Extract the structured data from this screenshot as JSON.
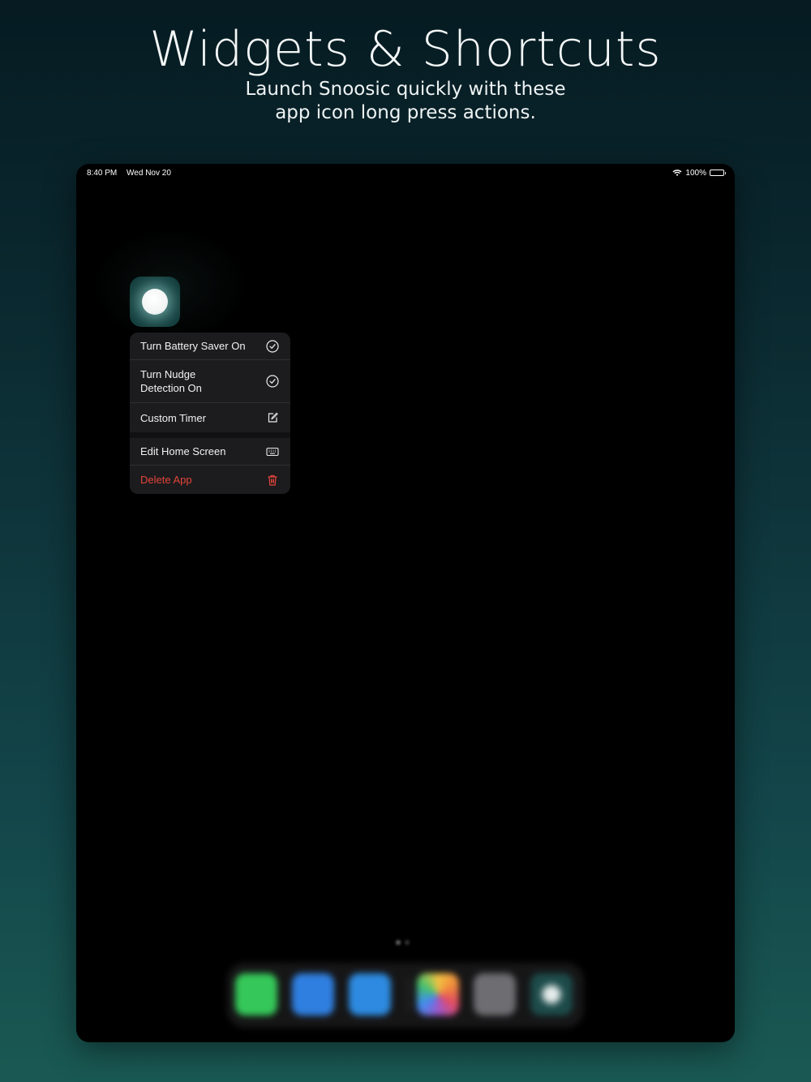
{
  "hero": {
    "title": "Widgets & Shortcuts",
    "subtitle_line1": "Launch Snoosic quickly with these",
    "subtitle_line2": "app icon long press actions."
  },
  "status_bar": {
    "time": "8:40 PM",
    "date": "Wed Nov 20",
    "battery_percent": "100%",
    "icons": [
      "wifi-icon",
      "battery-icon"
    ]
  },
  "app": {
    "icon": "moon-icon"
  },
  "context_menu": {
    "items": [
      {
        "label": "Turn Battery Saver On",
        "icon": "checkmark-circle-icon"
      },
      {
        "label": "Turn Nudge Detection On",
        "icon": "checkmark-circle-icon"
      },
      {
        "label": "Custom Timer",
        "icon": "edit-icon"
      },
      {
        "label": "Edit Home Screen",
        "icon": "keyboard-icon"
      },
      {
        "label": "Delete App",
        "icon": "trash-icon",
        "destructive": true
      }
    ]
  },
  "dock": {
    "apps": [
      {
        "name": "messages-icon",
        "color": "#35c759"
      },
      {
        "name": "safari-icon",
        "color": "#2f7fe0"
      },
      {
        "name": "files-icon",
        "color": "#2d8ae0"
      },
      {
        "name": "photos-icon",
        "color": "#e8a23c"
      },
      {
        "name": "settings-icon",
        "color": "#6e6e72"
      },
      {
        "name": "snoosic-icon",
        "color": "#1d4b4a"
      }
    ]
  },
  "colors": {
    "destructive": "#e5453b",
    "menu_background": "#1c1c1e",
    "device_background": "#000000"
  }
}
